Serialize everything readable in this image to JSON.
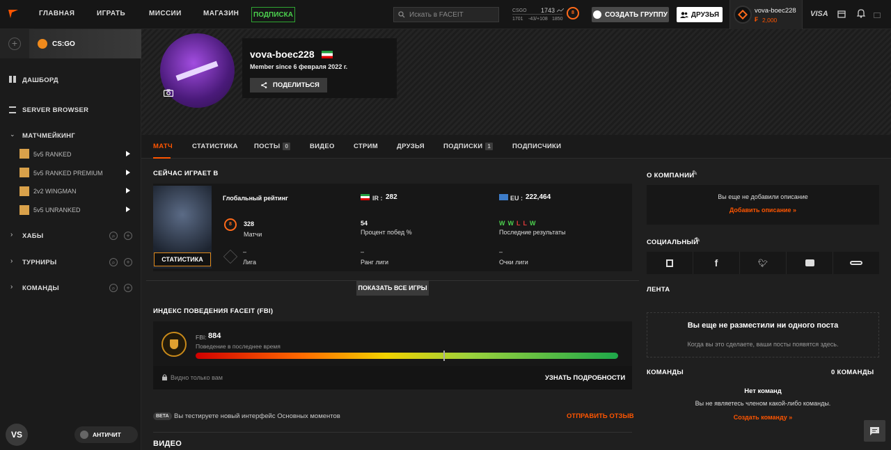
{
  "topnav": {
    "home": "ГЛАВНАЯ",
    "play": "ИГРАТЬ",
    "missions": "МИССИИ",
    "shop": "МАГАЗИН",
    "subscription": "ПОДПИСКА"
  },
  "search": {
    "placeholder": "Искать в FACEIT"
  },
  "elo": {
    "game": "CSGO",
    "value": "1743",
    "min": "1701",
    "delta": "-43/+108",
    "max": "1850",
    "level": "8"
  },
  "buttons": {
    "create_group": "СОЗДАТЬ ГРУППУ",
    "friends": "ДРУЗЬЯ",
    "share": "ПОДЕЛИТЬСЯ",
    "show_all_games": "ПОКАЗАТЬ ВСЕ ИГРЫ",
    "learn_more": "УЗНАТЬ ПОДРОБНОСТИ",
    "send_feedback": "ОТПРАВИТЬ ОТЗЫВ",
    "anticheat": "АНТИЧИТ"
  },
  "user": {
    "name": "vova-boec228",
    "points": "2,000",
    "member_since": "Member since 6 февраля 2022 г.",
    "avatar_initials": "VS"
  },
  "sidebar": {
    "game": "CS:GO",
    "dashboard": "ДАШБОРД",
    "server_browser": "SERVER BROWSER",
    "matchmaking": "МАТЧМЕЙКИНГ",
    "queues": [
      "5v5 RANKED",
      "5v5 RANKED PREMIUM",
      "2v2 WINGMAN",
      "5v5 UNRANKED"
    ],
    "hubs": "ХАБЫ",
    "tournaments": "ТУРНИРЫ",
    "teams": "КОМАНДЫ"
  },
  "tabs": [
    {
      "label": "МАТЧ"
    },
    {
      "label": "СТАТИСТИКА"
    },
    {
      "label": "ПОСТЫ",
      "badge": "0"
    },
    {
      "label": "ВИДЕО"
    },
    {
      "label": "СТРИМ"
    },
    {
      "label": "ДРУЗЬЯ"
    },
    {
      "label": "ПОДПИСКИ",
      "badge": "1"
    },
    {
      "label": "ПОДПИСЧИКИ"
    }
  ],
  "playing": {
    "title": "СЕЙЧАС ИГРАЕТ В",
    "stats_label": "СТАТИСТИКА",
    "global_rank": "Глобальный рейтинг",
    "ir_label": "IR :",
    "ir_value": "282",
    "eu_label": "EU :",
    "eu_value": "222,464",
    "matches_value": "328",
    "matches_label": "Матчи",
    "winrate_value": "54",
    "winrate_label": "Процент побед %",
    "results": [
      "W",
      "W",
      "L",
      "L",
      "W"
    ],
    "results_label": "Последние результаты",
    "league_value": "–",
    "league_label": "Лига",
    "league_rank_value": "–",
    "league_rank_label": "Ранг лиги",
    "league_points_value": "–",
    "league_points_label": "Очки лиги"
  },
  "fbi": {
    "title": "ИНДЕКС ПОВЕДЕНИЯ FACEIT (FBI)",
    "label": "FBI:",
    "value": "884",
    "fraction": 0.586,
    "subtitle": "Поведение в последнее время",
    "visibility": "Видно только вам"
  },
  "beta": {
    "tag": "BETA",
    "text": "Вы тестируете новый интерфейс Основных моментов"
  },
  "video_title": "ВИДЕО",
  "about": {
    "title": "О КОМПАНИИ",
    "empty": "Вы еще не добавили описание",
    "add": "Добавить описание »"
  },
  "social": {
    "title": "СОЦИАЛЬНЫЙ"
  },
  "feed": {
    "title": "ЛЕНТА",
    "empty_title": "Вы еще не разместили ни одного поста",
    "empty_text": "Когда вы это сделаете, ваши посты появятся здесь."
  },
  "teams": {
    "title": "КОМАНДЫ",
    "count": "0 КОМАНДЫ",
    "none": "Нет команд",
    "not_member": "Вы не являетесь членом какой-либо команды.",
    "create": "Создать команду »"
  },
  "colors": {
    "accent": "#ff5500",
    "success": "#4cd14e",
    "panel": "#171717"
  }
}
